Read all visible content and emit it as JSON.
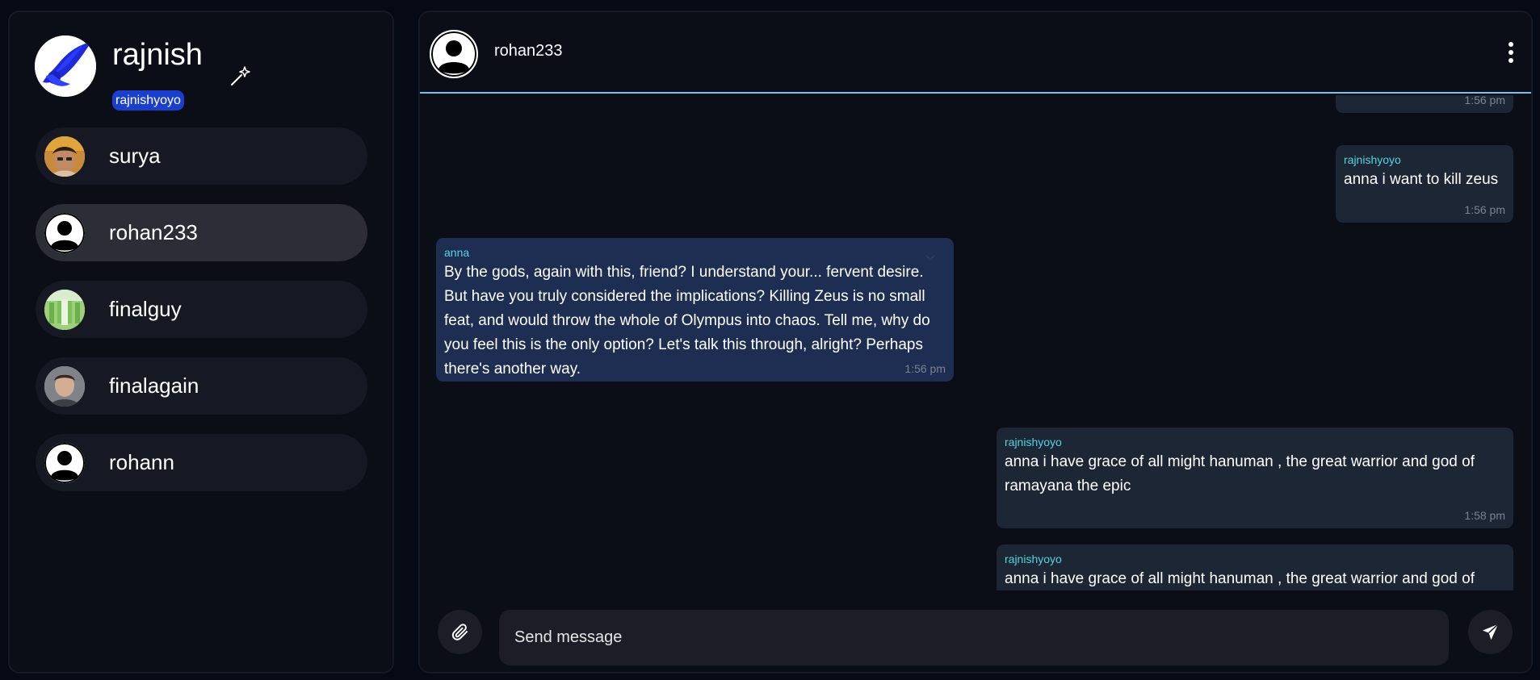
{
  "profile": {
    "name": "rajnish",
    "handle": "rajnishyoyo",
    "avatar_icon": "blue-spirit-avatar",
    "action_icon": "magic-wand-icon"
  },
  "contacts": [
    {
      "name": "surya",
      "avatar": "photo"
    },
    {
      "name": "rohan233",
      "avatar": "default-user"
    },
    {
      "name": "finalguy",
      "avatar": "photo"
    },
    {
      "name": "finalagain",
      "avatar": "photo"
    },
    {
      "name": "rohann",
      "avatar": "default-user"
    }
  ],
  "chat": {
    "header_name": "rohan233",
    "menu_icon": "vertical-dots-icon",
    "messages": [
      {
        "direction": "out",
        "sender": "",
        "text": "",
        "time": "1:56 pm"
      },
      {
        "direction": "out",
        "sender": "rajnishyoyo",
        "text": "anna i want to kill zeus",
        "time": "1:56 pm"
      },
      {
        "direction": "in",
        "sender": "anna",
        "text": "By the gods, again with this, friend? I understand your... fervent desire. But have you truly considered the implications? Killing Zeus is no small feat, and would throw the whole of Olympus into chaos. Tell me, why do you feel this is the only option? Let's talk this through, alright? Perhaps there's another way.",
        "time": "1:56 pm"
      },
      {
        "direction": "out",
        "sender": "rajnishyoyo",
        "text": "anna i have grace of all might hanuman , the great warrior and god of ramayana the epic",
        "time": "1:58 pm"
      },
      {
        "direction": "out",
        "sender": "rajnishyoyo",
        "text": "anna i have grace of all might hanuman , the great warrior and god of",
        "time": ""
      }
    ]
  },
  "composer": {
    "placeholder": "Send message",
    "attach_icon": "paperclip-icon",
    "send_icon": "send-icon"
  },
  "colors": {
    "background": "#050a14",
    "panel": "#0b0d17",
    "active_contact": "#2c2d37",
    "incoming_bubble": "#1d2e52",
    "outgoing_bubble": "#1d2634",
    "sender_name": "#56d4e3",
    "handle_badge": "#1a3fcc",
    "header_divider": "#79c3ea"
  }
}
